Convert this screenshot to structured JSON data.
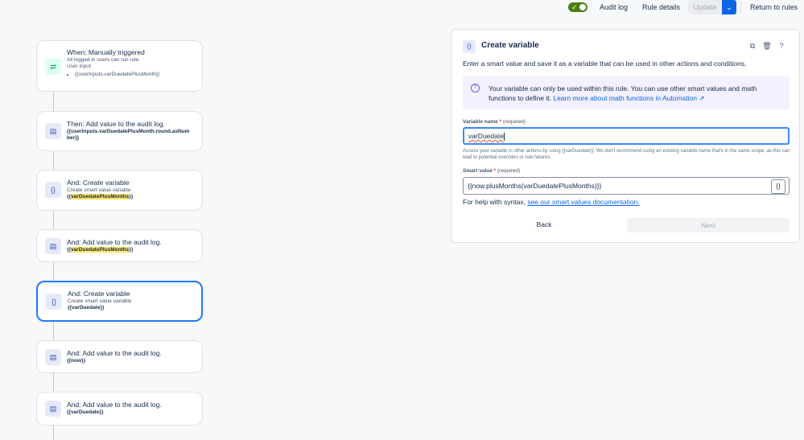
{
  "header": {
    "audit_log": "Audit log",
    "rule_details": "Rule details",
    "update": "Update",
    "return": "Return to rules"
  },
  "flow": {
    "trigger": {
      "title": "When: Manually triggered",
      "line1": "All logged in users can run rule.",
      "line2": "User input:",
      "bullet": "{{userInputs.varDuedatePlusMonth}}"
    },
    "step1": {
      "title": "Then: Add value to the audit log.",
      "value": "{{userInputs.varDuedatePlusMonth.round.asNumber}}"
    },
    "step2": {
      "title": "And: Create variable",
      "sub": "Create smart value variable",
      "pre": "{{",
      "hl": "varDuedatePlusMonths",
      "post": "}}"
    },
    "step3": {
      "title": "And: Add value to the audit log.",
      "pre": "{{",
      "hl": "varDuedatePlusMonths",
      "post": "}}"
    },
    "step4": {
      "title": "And: Create variable",
      "sub": "Create smart value variable",
      "value": "{{varDuedate}}"
    },
    "step5": {
      "title": "And: Add value to the audit log.",
      "value": "{{now}}"
    },
    "step6": {
      "title": "And: Add value to the audit log.",
      "value": "{{varDuedate}}"
    }
  },
  "panel": {
    "title": "Create variable",
    "description": "Enter a smart value and save it as a variable that can be used in other actions and conditions.",
    "info_text": "Your variable can only be used within this rule. You can use other smart values and math functions to define it.",
    "info_link": "Learn more about math functions in Automation ↗",
    "var_label": "Variable name",
    "req_mark": "*",
    "required": "(required)",
    "var_value": "varDuedate",
    "help_text": "Access your variable in other actions by using {{varDuedate}}. We don't recommend using an existing variable name that's in the same scope, as this can lead to potential overrides or rule failures.",
    "smart_label": "Smart value",
    "smart_value": "{{now.plusMonths(varDuedatePlusMonths)}}",
    "syntax_text": "For help with syntax,",
    "syntax_link": "see our smart values documentation.",
    "back": "Back",
    "next": "Next"
  },
  "colors": {
    "accent": "#1d7afc",
    "toggle": "#4b7d16",
    "highlight": "#f8e462",
    "info_bg": "#f3f0ff"
  }
}
